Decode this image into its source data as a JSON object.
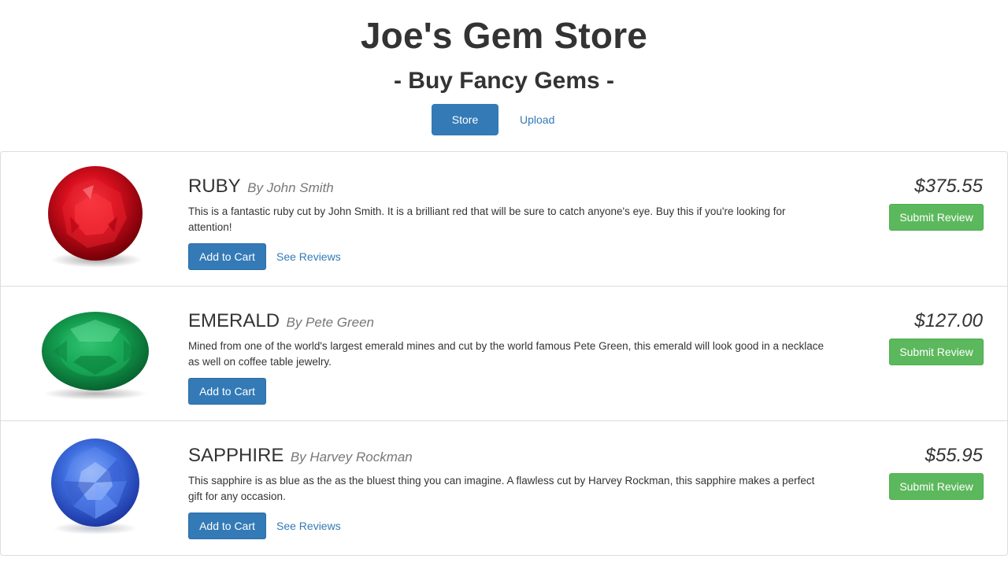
{
  "header": {
    "title": "Joe's Gem Store",
    "subtitle": "- Buy Fancy Gems -"
  },
  "nav": {
    "tabs": [
      {
        "label": "Store",
        "active": true
      },
      {
        "label": "Upload",
        "active": false
      }
    ]
  },
  "colors": {
    "primary": "#337ab7",
    "success": "#5cb85c",
    "ruby": "#d0101c",
    "emerald": "#1a9a4a",
    "sapphire": "#3a66d8"
  },
  "products": [
    {
      "name": "RUBY",
      "author": "By John Smith",
      "description": "This is a fantastic ruby cut by John Smith. It is a brilliant red that will be sure to catch anyone's eye. Buy this if you're looking for attention!",
      "price": "$375.55",
      "add_label": "Add to Cart",
      "reviews_label": "See Reviews",
      "review_button": "Submit Review",
      "image_icon": "ruby-gem-image"
    },
    {
      "name": "EMERALD",
      "author": "By Pete Green",
      "description": "Mined from one of the world's largest emerald mines and cut by the world famous Pete Green, this emerald will look good in a necklace as well on coffee table jewelry.",
      "price": "$127.00",
      "add_label": "Add to Cart",
      "review_button": "Submit Review",
      "image_icon": "emerald-gem-image"
    },
    {
      "name": "SAPPHIRE",
      "author": "By Harvey Rockman",
      "description": "This sapphire is as blue as the as the bluest thing you can imagine. A flawless cut by Harvey Rockman, this sapphire makes a perfect gift for any occasion.",
      "price": "$55.95",
      "add_label": "Add to Cart",
      "reviews_label": "See Reviews",
      "review_button": "Submit Review",
      "image_icon": "sapphire-gem-image"
    }
  ]
}
